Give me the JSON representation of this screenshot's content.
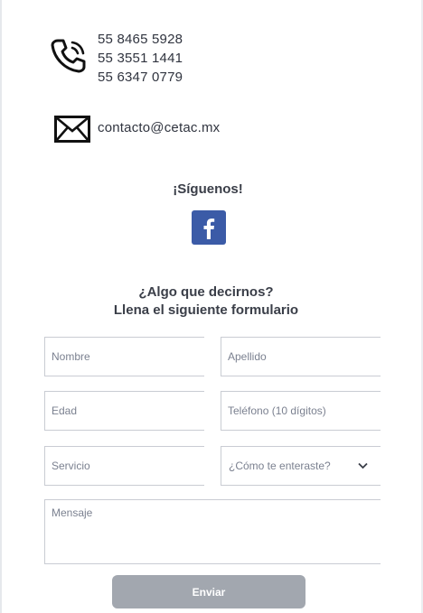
{
  "contact": {
    "phones": [
      "55 8465 5928",
      "55 3551 1441",
      "55 6347 0779"
    ],
    "email": "contacto@cetac.mx",
    "phone_icon": "phone-call-icon",
    "mail_icon": "envelope-icon"
  },
  "social": {
    "heading": "¡Síguenos!",
    "facebook_icon": "facebook-icon",
    "facebook_color": "#3b5ba7"
  },
  "form": {
    "heading_line1": "¿Algo que decirnos?",
    "heading_line2": "Llena el siguiente formulario",
    "nombre_placeholder": "Nombre",
    "apellido_placeholder": "Apellido",
    "edad_placeholder": "Edad",
    "telefono_placeholder": "Teléfono (10 dígitos)",
    "servicio_placeholder": "Servicio",
    "como_selected": "¿Cómo te enteraste?",
    "mensaje_placeholder": "Mensaje",
    "submit_label": "Enviar",
    "submit_color": "#a2a7af"
  }
}
